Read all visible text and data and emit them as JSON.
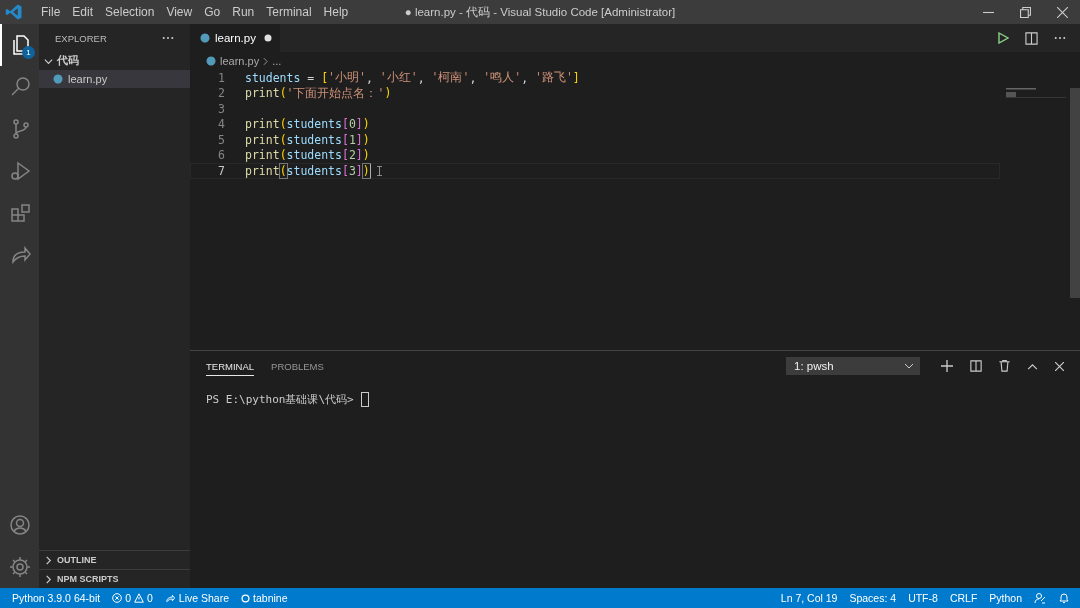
{
  "window": {
    "title": "● learn.py - 代码 - Visual Studio Code [Administrator]"
  },
  "menu": [
    "File",
    "Edit",
    "Selection",
    "View",
    "Go",
    "Run",
    "Terminal",
    "Help"
  ],
  "activity_bar": {
    "items": [
      {
        "kind": "files",
        "selected": true,
        "badge": "1"
      },
      {
        "kind": "search",
        "selected": false
      },
      {
        "kind": "source-control",
        "selected": false
      },
      {
        "kind": "run",
        "selected": false
      },
      {
        "kind": "extensions",
        "selected": false
      },
      {
        "kind": "live-share",
        "selected": false
      }
    ],
    "bottom": [
      {
        "kind": "account"
      },
      {
        "kind": "settings"
      }
    ]
  },
  "sidebar": {
    "title": "EXPLORER",
    "tree": [
      {
        "label": "代码",
        "expanded": true,
        "children": [
          {
            "label": "learn.py",
            "selected": true
          }
        ]
      }
    ],
    "sections": [
      {
        "label": "OUTLINE",
        "expanded": false
      },
      {
        "label": "NPM SCRIPTS",
        "expanded": false
      }
    ]
  },
  "tabs": [
    {
      "label": "learn.py",
      "selected": true,
      "modified": true
    }
  ],
  "breadcrumb": [
    "learn.py",
    "..."
  ],
  "editor": {
    "lines": [
      {
        "number": "1",
        "current": false,
        "tokens": [
          {
            "text": "students",
            "kind": "var"
          },
          {
            "text": " = ",
            "kind": "punct"
          },
          {
            "text": "[",
            "kind": "bracket"
          },
          {
            "text": "'小明'",
            "kind": "str"
          },
          {
            "text": ", ",
            "kind": "punct"
          },
          {
            "text": "'小红'",
            "kind": "str"
          },
          {
            "text": ", ",
            "kind": "punct"
          },
          {
            "text": "'柯南'",
            "kind": "str"
          },
          {
            "text": ", ",
            "kind": "punct"
          },
          {
            "text": "'鸣人'",
            "kind": "str"
          },
          {
            "text": ", ",
            "kind": "punct"
          },
          {
            "text": "'路飞'",
            "kind": "str"
          },
          {
            "text": "]",
            "kind": "bracket"
          }
        ]
      },
      {
        "number": "2",
        "current": false,
        "tokens": [
          {
            "text": "print",
            "kind": "fn"
          },
          {
            "text": "(",
            "kind": "bracket"
          },
          {
            "text": "'下面开始点名：'",
            "kind": "str"
          },
          {
            "text": ")",
            "kind": "bracket"
          }
        ]
      },
      {
        "number": "3",
        "current": false
      },
      {
        "number": "4",
        "current": false,
        "tokens": [
          {
            "text": "print",
            "kind": "fn"
          },
          {
            "text": "(",
            "kind": "bracket"
          },
          {
            "text": "students",
            "kind": "var"
          },
          {
            "text": "[",
            "kind": "bracket2"
          },
          {
            "text": "0",
            "kind": "num"
          },
          {
            "text": "]",
            "kind": "bracket2"
          },
          {
            "text": ")",
            "kind": "bracket"
          }
        ]
      },
      {
        "number": "5",
        "current": false,
        "tokens": [
          {
            "text": "print",
            "kind": "fn"
          },
          {
            "text": "(",
            "kind": "bracket"
          },
          {
            "text": "students",
            "kind": "var"
          },
          {
            "text": "[",
            "kind": "bracket2"
          },
          {
            "text": "1",
            "kind": "num"
          },
          {
            "text": "]",
            "kind": "bracket2"
          },
          {
            "text": ")",
            "kind": "bracket"
          }
        ]
      },
      {
        "number": "6",
        "current": false,
        "tokens": [
          {
            "text": "print",
            "kind": "fn"
          },
          {
            "text": "(",
            "kind": "bracket"
          },
          {
            "text": "students",
            "kind": "var"
          },
          {
            "text": "[",
            "kind": "bracket2"
          },
          {
            "text": "2",
            "kind": "num"
          },
          {
            "text": "]",
            "kind": "bracket2"
          },
          {
            "text": ")",
            "kind": "bracket"
          }
        ]
      },
      {
        "number": "7",
        "current": true,
        "tokens": [
          {
            "text": "print",
            "kind": "fn"
          },
          {
            "text": "(",
            "kind": "bracket",
            "matched": true
          },
          {
            "text": "students",
            "kind": "var"
          },
          {
            "text": "[",
            "kind": "bracket2"
          },
          {
            "text": "3",
            "kind": "num"
          },
          {
            "text": "]",
            "kind": "bracket2"
          },
          {
            "text": ")",
            "kind": "bracket",
            "matched": true
          }
        ]
      }
    ]
  },
  "panel": {
    "tabs": [
      {
        "label": "TERMINAL",
        "selected": true
      },
      {
        "label": "PROBLEMS",
        "selected": false
      }
    ],
    "terminal_select": "1: pwsh",
    "prompt": "PS E:\\python基础课\\代码>"
  },
  "status_bar": {
    "left": [
      {
        "kind": "text",
        "label": "Python 3.9.0 64-bit"
      },
      {
        "kind": "problems",
        "errors": "0",
        "warnings": "0"
      },
      {
        "kind": "live-share",
        "label": "Live Share"
      },
      {
        "kind": "tabnine",
        "label": "tabnine"
      }
    ],
    "right": [
      "Ln 7, Col 19",
      "Spaces: 4",
      "UTF-8",
      "CRLF",
      "Python"
    ]
  }
}
